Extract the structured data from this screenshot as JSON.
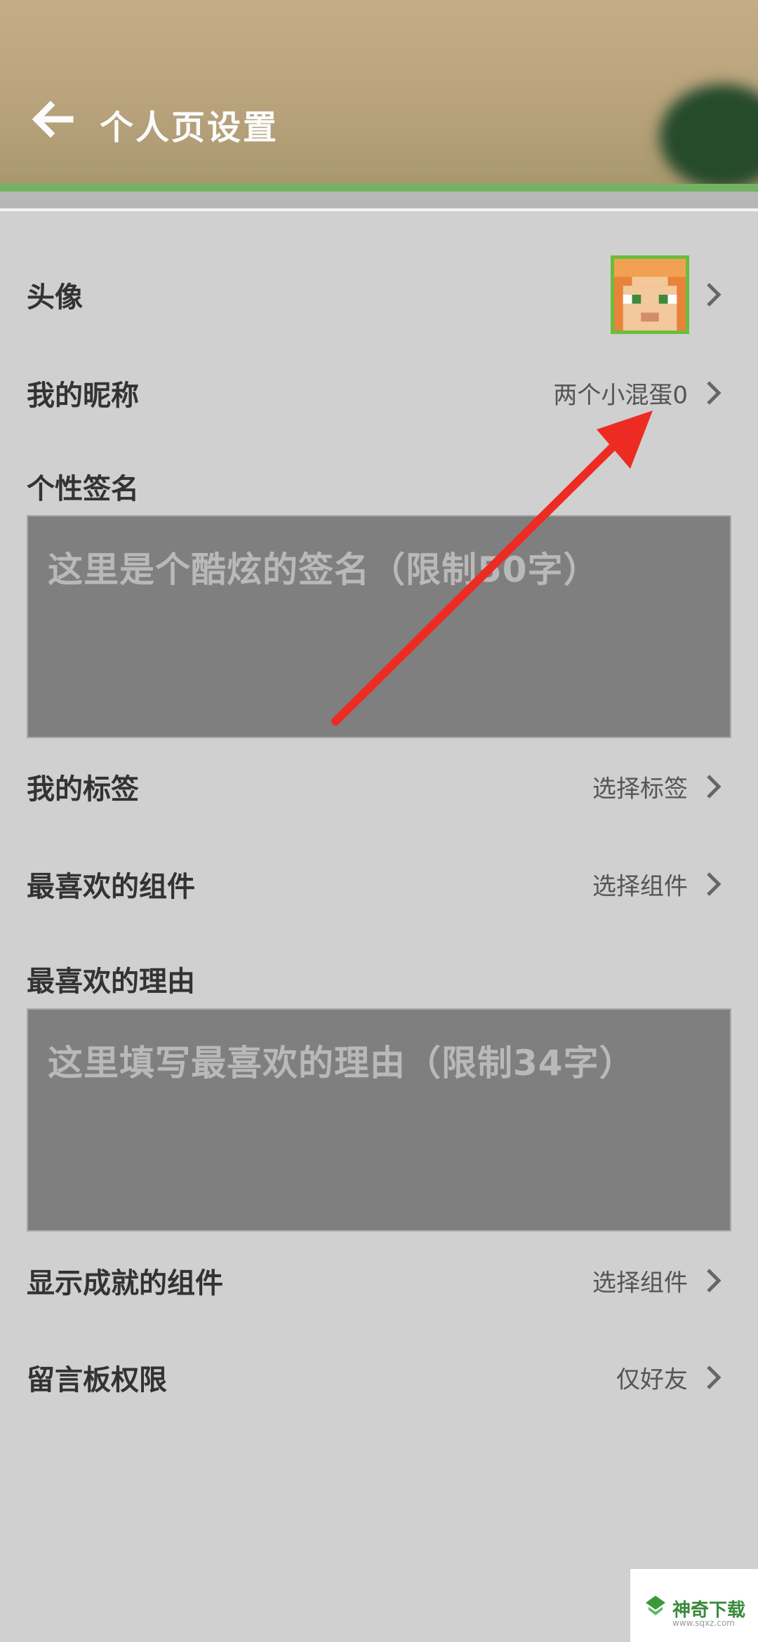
{
  "header": {
    "title": "个人页设置"
  },
  "rows": {
    "avatar": {
      "label": "头像"
    },
    "nickname": {
      "label": "我的昵称",
      "value": "两个小混蛋0"
    },
    "signature": {
      "label": "个性签名",
      "placeholder": "这里是个酷炫的签名（限制50字）"
    },
    "tags": {
      "label": "我的标签",
      "value": "选择标签"
    },
    "favorite_component": {
      "label": "最喜欢的组件",
      "value": "选择组件"
    },
    "favorite_reason": {
      "label": "最喜欢的理由",
      "placeholder": "这里填写最喜欢的理由（限制34字）"
    },
    "achievement_component": {
      "label": "显示成就的组件",
      "value": "选择组件"
    },
    "message_board": {
      "label": "留言板权限",
      "value": "仅好友"
    }
  },
  "watermark": {
    "text": "神奇下载",
    "sub": "www.sqxz.com"
  },
  "colors": {
    "accent_green": "#72b262",
    "annotation_arrow": "#ee2b23"
  }
}
